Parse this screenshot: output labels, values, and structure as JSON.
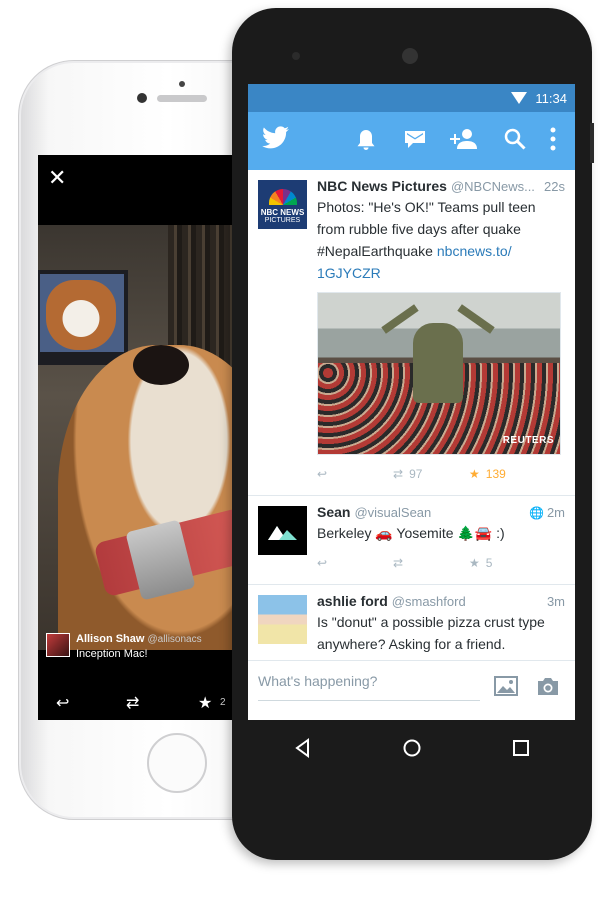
{
  "iphone": {
    "close_icon": "close-icon",
    "attribution": {
      "name": "Allison Shaw",
      "handle": "@allisonacs",
      "text": "Inception Mac!"
    },
    "actions": {
      "fav_count": "2"
    }
  },
  "android": {
    "status": {
      "time": "11:34"
    },
    "appbar": {
      "icons": [
        "twitter-bird-icon",
        "notifications-icon",
        "messages-icon",
        "add-user-icon",
        "search-icon",
        "overflow-menu-icon"
      ]
    },
    "tweets": [
      {
        "name": "NBC News Pictures",
        "handle": "@NBCNews...",
        "time": "22s",
        "text": "Photos: \"He's OK!\" Teams pull teen from rubble five days after quake #NepalEarthquake ",
        "link": "nbcnews.to/ 1GJYCZR",
        "avatar_t1": "NBC NEWS",
        "avatar_t2": "PICTURES",
        "media_credit": "REUTERS",
        "retweets": "97",
        "favorites": "139"
      },
      {
        "name": "Sean",
        "handle": "@visualSean",
        "time": "2m",
        "text": "Berkeley 🚗 Yosemite 🌲🚘 :)",
        "favorites": "5"
      },
      {
        "name": "ashlie ford",
        "handle": "@smashford",
        "time": "3m",
        "text": "Is \"donut\" a possible pizza crust type anywhere? Asking for a friend."
      }
    ],
    "compose": {
      "placeholder": "What's happening?"
    },
    "colors": {
      "twitter_blue": "#55acee",
      "status_blue": "#3a86c5",
      "star_gold": "#ffac33"
    }
  }
}
